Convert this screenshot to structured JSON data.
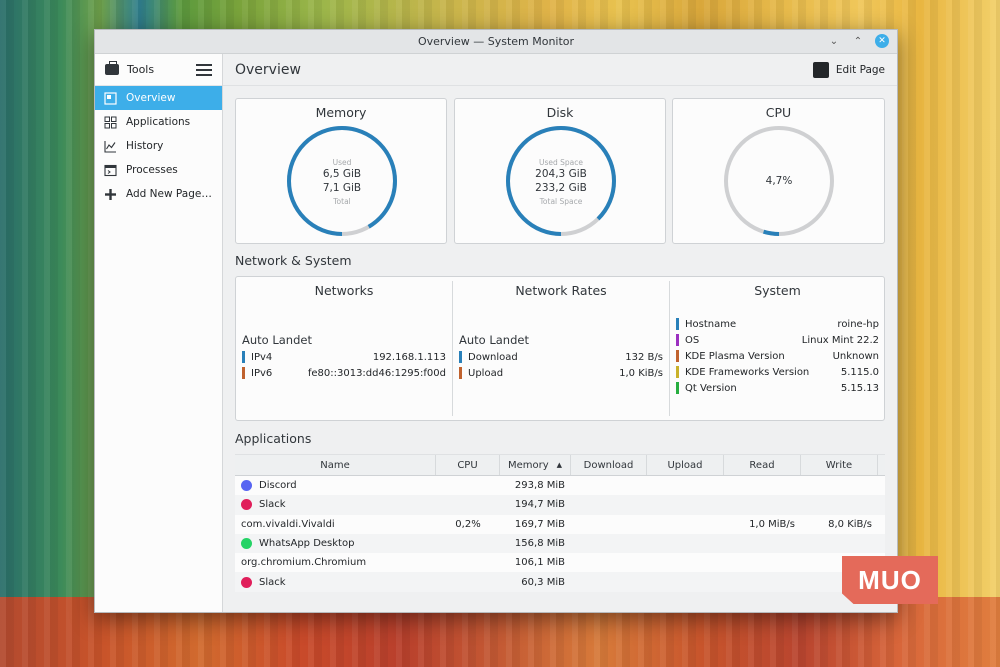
{
  "window": {
    "title": "Overview — System Monitor"
  },
  "sidebar": {
    "tools_label": "Tools",
    "items": [
      {
        "label": "Overview",
        "icon": "overview-icon",
        "active": true
      },
      {
        "label": "Applications",
        "icon": "applications-grid-icon",
        "active": false
      },
      {
        "label": "History",
        "icon": "history-chart-icon",
        "active": false
      },
      {
        "label": "Processes",
        "icon": "processes-window-icon",
        "active": false
      },
      {
        "label": "Add New Page…",
        "icon": "plus-icon",
        "active": false
      }
    ]
  },
  "header": {
    "title": "Overview",
    "edit_label": "Edit Page"
  },
  "gauges": {
    "memory": {
      "title": "Memory",
      "used_label": "Used",
      "used": "6,5 GiB",
      "total": "7,1 GiB",
      "total_label": "Total",
      "fraction": 0.915
    },
    "disk": {
      "title": "Disk",
      "used_label": "Used Space",
      "used": "204,3 GiB",
      "total": "233,2 GiB",
      "total_label": "Total Space",
      "fraction": 0.876
    },
    "cpu": {
      "title": "CPU",
      "value": "4,7%",
      "fraction": 0.047
    }
  },
  "network_system": {
    "section_title": "Network & System",
    "networks": {
      "title": "Networks",
      "subtitle": "Auto Landet",
      "rows": [
        {
          "key": "IPv4",
          "value": "192.168.1.113",
          "color": "#2980b9"
        },
        {
          "key": "IPv6",
          "value": "fe80::3013:dd46:1295:f00d",
          "color": "#c0622e"
        }
      ]
    },
    "rates": {
      "title": "Network Rates",
      "subtitle": "Auto Landet",
      "rows": [
        {
          "key": "Download",
          "value": "132 B/s",
          "color": "#2980b9"
        },
        {
          "key": "Upload",
          "value": "1,0 KiB/s",
          "color": "#c0622e"
        }
      ]
    },
    "system": {
      "title": "System",
      "rows": [
        {
          "key": "Hostname",
          "value": "roine-hp",
          "color": "#2980b9"
        },
        {
          "key": "OS",
          "value": "Linux Mint 22.2",
          "color": "#9b30c0"
        },
        {
          "key": "KDE Plasma Version",
          "value": "Unknown",
          "color": "#c0622e"
        },
        {
          "key": "KDE Frameworks Version",
          "value": "5.115.0",
          "color": "#c9b12a"
        },
        {
          "key": "Qt Version",
          "value": "5.15.13",
          "color": "#27ae40"
        }
      ]
    }
  },
  "applications": {
    "section_title": "Applications",
    "columns": [
      "Name",
      "CPU",
      "Memory",
      "Download",
      "Upload",
      "Read",
      "Write"
    ],
    "rows": [
      {
        "name": "Discord",
        "icon": "discord-icon",
        "cpu": "",
        "memory": "293,8 MiB",
        "download": "",
        "upload": "",
        "read": "",
        "write": ""
      },
      {
        "name": "Slack",
        "icon": "slack-icon",
        "cpu": "",
        "memory": "194,7 MiB",
        "download": "",
        "upload": "",
        "read": "",
        "write": ""
      },
      {
        "name": "com.vivaldi.Vivaldi",
        "icon": "",
        "cpu": "0,2%",
        "memory": "169,7 MiB",
        "download": "",
        "upload": "",
        "read": "1,0 MiB/s",
        "write": "8,0 KiB/s"
      },
      {
        "name": "WhatsApp Desktop",
        "icon": "whatsapp-icon",
        "cpu": "",
        "memory": "156,8 MiB",
        "download": "",
        "upload": "",
        "read": "",
        "write": ""
      },
      {
        "name": "org.chromium.Chromium",
        "icon": "",
        "cpu": "",
        "memory": "106,1 MiB",
        "download": "",
        "upload": "",
        "read": "",
        "write": ""
      },
      {
        "name": "Slack",
        "icon": "slack-icon",
        "cpu": "",
        "memory": "60,3 MiB",
        "download": "",
        "upload": "",
        "read": "",
        "write": ""
      }
    ]
  },
  "watermark": "MUO",
  "colors": {
    "accent": "#3daee9",
    "gauge_fill": "#2980b9",
    "gauge_track": "#cfd0d2"
  }
}
